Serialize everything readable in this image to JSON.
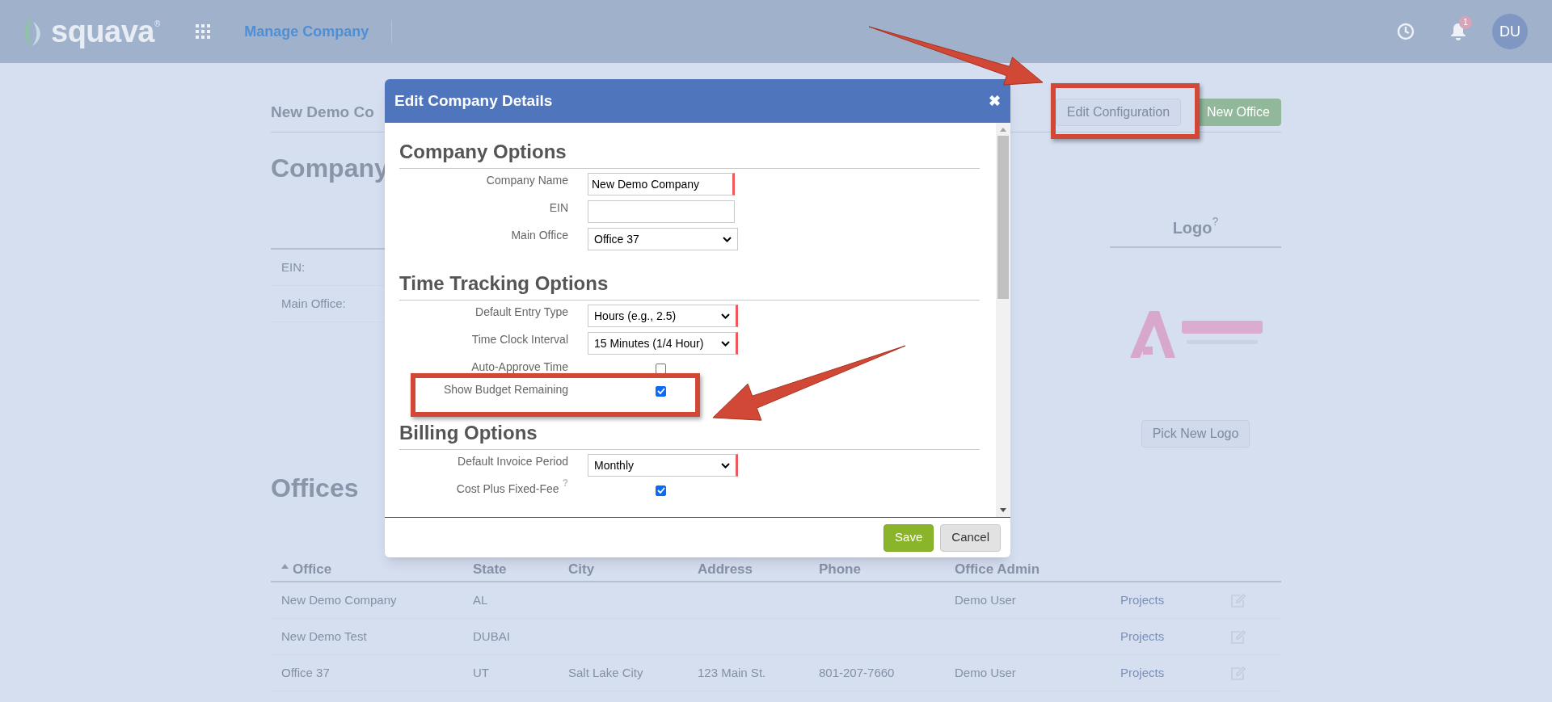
{
  "top_bar": {
    "brand": "squava",
    "brand_mark": "®",
    "title": "Manage Company",
    "notification_count": "1",
    "avatar": "DU"
  },
  "page": {
    "title": "New Demo Co",
    "buttons": [
      {
        "label": "Edit Configuration",
        "kind": "secondary"
      },
      {
        "label": "New Office",
        "kind": "primary"
      }
    ],
    "company_heading": "Company",
    "company_fields": [
      {
        "label": "EIN:"
      },
      {
        "label": "Main Office:"
      }
    ],
    "logo_heading": "Logo",
    "logo_help": "?",
    "logo_button": "Pick New Logo"
  },
  "offices": {
    "heading": "Offices",
    "columns": [
      {
        "label": "Office",
        "sorted": true
      },
      {
        "label": "State",
        "sorted": false
      },
      {
        "label": "City",
        "sorted": false
      },
      {
        "label": "Address",
        "sorted": false
      },
      {
        "label": "Phone",
        "sorted": false
      },
      {
        "label": "Office Admin",
        "sorted": false
      }
    ],
    "rows": [
      {
        "office": "New Demo Company",
        "state": "AL",
        "admin": "Demo User",
        "link": "Projects"
      },
      {
        "office": "New Demo Test",
        "state": "DUBAI",
        "link": "Projects"
      },
      {
        "office": "Office 37",
        "state": "UT",
        "city": "Salt Lake City",
        "address": "123 Main St.",
        "phone": "801-207-7660",
        "admin": "Demo User",
        "link": "Projects"
      }
    ]
  },
  "dialog": {
    "title": "Edit Company Details",
    "close": "✖",
    "sections": [
      {
        "title": "Company Options",
        "fields": [
          {
            "kind": "text",
            "label": "Company Name",
            "value": "New Demo Company",
            "required": true
          },
          {
            "kind": "text",
            "label": "EIN",
            "required": false
          },
          {
            "kind": "select",
            "label": "Main Office",
            "value": "Office 37",
            "required": false
          }
        ]
      },
      {
        "title": "Time Tracking Options",
        "fields": [
          {
            "kind": "select",
            "label": "Default Entry Type",
            "value": "Hours (e.g., 2.5)",
            "required": true
          },
          {
            "kind": "select",
            "label": "Time Clock Interval",
            "value": "15 Minutes (1/4 Hour)",
            "required": true
          },
          {
            "kind": "checkbox",
            "label": "Auto-Approve Time",
            "checked": false
          },
          {
            "kind": "checkbox",
            "label": "Show Budget Remaining",
            "checked": true
          }
        ]
      },
      {
        "title": "Billing Options",
        "fields": [
          {
            "kind": "select",
            "label": "Default Invoice Period",
            "value": "Monthly",
            "required": true
          },
          {
            "kind": "checkbox",
            "label": "Cost Plus Fixed-Fee",
            "help": "?",
            "checked": true
          }
        ]
      }
    ],
    "buttons": [
      {
        "label": "Save",
        "kind": "primary"
      },
      {
        "label": "Cancel",
        "kind": "secondary"
      }
    ]
  }
}
